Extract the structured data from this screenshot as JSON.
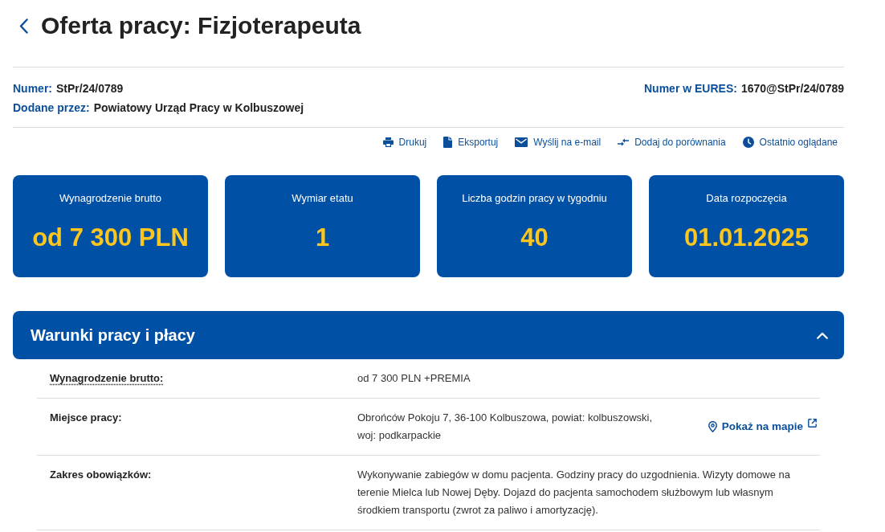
{
  "page": {
    "title": "Oferta pracy: Fizjoterapeuta"
  },
  "meta": {
    "left": [
      {
        "label": "Numer:",
        "value": "StPr/24/0789"
      },
      {
        "label": "Dodane przez:",
        "value": "Powiatowy Urząd Pracy w Kolbuszowej"
      }
    ],
    "right": [
      {
        "label": "Numer w EURES:",
        "value": "1670@StPr/24/0789"
      }
    ]
  },
  "actions": [
    {
      "kind": "print",
      "label": "Drukuj"
    },
    {
      "kind": "export",
      "label": "Eksportuj"
    },
    {
      "kind": "email",
      "label": "Wyślij na e-mail"
    },
    {
      "kind": "compare",
      "label": "Dodaj do porównania"
    },
    {
      "kind": "recent",
      "label": "Ostatnio oglądane"
    }
  ],
  "stats": [
    {
      "label": "Wynagrodzenie brutto",
      "value": "od 7 300 PLN"
    },
    {
      "label": "Wymiar etatu",
      "value": "1"
    },
    {
      "label": "Liczba godzin pracy w tygodniu",
      "value": "40"
    },
    {
      "label": "Data rozpoczęcia",
      "value": "01.01.2025"
    }
  ],
  "section": {
    "title": "Warunki pracy i płacy",
    "expanded": true,
    "rows": [
      {
        "label": "Wynagrodzenie brutto:",
        "abbr": true,
        "value": "od 7 300 PLN +PREMIA"
      },
      {
        "label": "Miejsce pracy:",
        "abbr": false,
        "value": "Obrońców Pokoju 7, 36-100 Kolbuszowa, powiat: kolbuszowski, woj: podkarpackie",
        "link": {
          "label": "Pokaż na mapie"
        }
      },
      {
        "label": "Zakres obowiązków:",
        "abbr": false,
        "value": "Wykonywanie zabiegów w domu pacjenta. Godziny pracy do uzgodnienia. Wizyty domowe na terenie Mielca lub Nowej Dęby. Dojazd do pacjenta samochodem służbowym lub własnym środkiem transportu (zwrot za paliwo i amortyzację)."
      }
    ]
  }
}
